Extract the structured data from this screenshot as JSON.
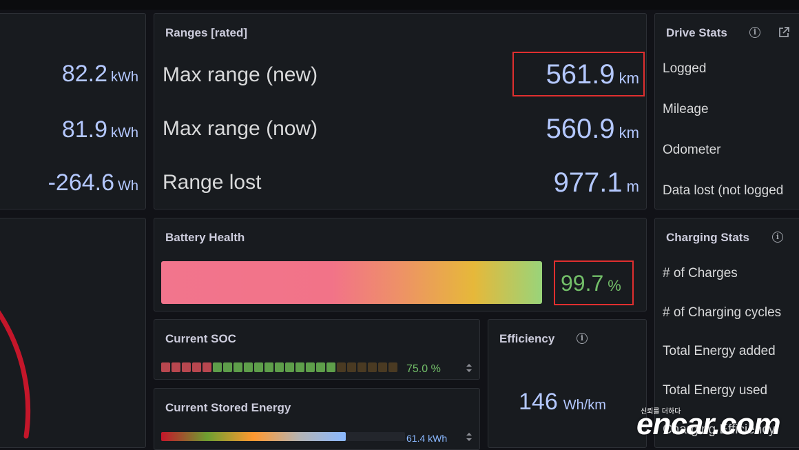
{
  "energy_panel": {
    "rows": [
      {
        "value": "82.2",
        "unit": "kWh"
      },
      {
        "value": "81.9",
        "unit": "kWh"
      },
      {
        "value": "-264.6",
        "unit": "Wh"
      }
    ]
  },
  "ranges_panel": {
    "title": "Ranges [rated]",
    "rows": [
      {
        "label": "Max range (new)",
        "value": "561.9",
        "unit": "km"
      },
      {
        "label": "Max range (now)",
        "value": "560.9",
        "unit": "km"
      },
      {
        "label": "Range lost",
        "value": "977.1",
        "unit": "m"
      }
    ]
  },
  "drive_stats": {
    "title": "Drive Stats",
    "labels": [
      "Logged",
      "Mileage",
      "Odometer",
      "Data lost (not logged"
    ]
  },
  "battery_health": {
    "title": "Battery Health",
    "value": "99.7",
    "unit": "%",
    "fraction": 0.997
  },
  "charging_stats": {
    "title": "Charging Stats",
    "labels": [
      "# of Charges",
      "# of Charging cycles",
      "Total Energy added",
      "Total Energy used",
      "Charging Efficiency"
    ]
  },
  "current_soc": {
    "title": "Current SOC",
    "value": "75.0",
    "unit": "%",
    "percent": 75.0
  },
  "efficiency": {
    "title": "Efficiency",
    "value": "146",
    "unit": "Wh/km"
  },
  "stored_energy": {
    "title": "Current Stored Energy",
    "value": "61.4",
    "unit": "kWh"
  },
  "watermark": {
    "small_text": "신뢰를 더하다",
    "brand": "encar.com"
  },
  "colors": {
    "value_blue": "#b4c8ff",
    "green": "#73bf69",
    "highlight_red": "#e02f2f",
    "panel_bg": "#181b1f",
    "page_bg": "#111217"
  }
}
